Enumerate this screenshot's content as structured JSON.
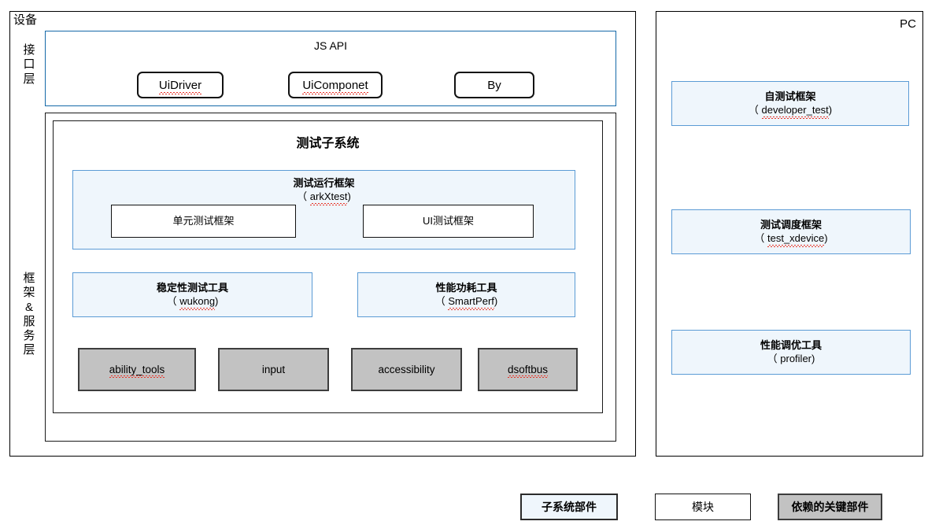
{
  "device_panel": {
    "tag": "设备",
    "layers": [
      {
        "id": "interface",
        "label": "接口层"
      },
      {
        "id": "framework_service",
        "label": "框架&服务层"
      }
    ],
    "js_api": {
      "title": "JS API",
      "chips": [
        {
          "label": "UiDriver",
          "misspelled": true
        },
        {
          "label": "UiComponet",
          "misspelled": true
        },
        {
          "label": "By",
          "misspelled": false
        }
      ]
    },
    "test_subsystem": {
      "title": "测试子系统",
      "run_framework": {
        "name": "测试运行框架",
        "pkg": "（ arkXtest)",
        "pkg_word": "arkXtest",
        "modules": [
          {
            "label": "单元测试框架"
          },
          {
            "label": "UI测试框架"
          }
        ]
      },
      "tools": [
        {
          "name": "稳定性测试工具",
          "pkg_open": "（ ",
          "pkg_word": "wukong",
          "pkg_close": ")"
        },
        {
          "name": "性能功耗工具",
          "pkg_open": "（ ",
          "pkg_word": "SmartPerf",
          "pkg_close": ")"
        }
      ],
      "dependencies": [
        {
          "label": "ability_tools",
          "misspelled": true
        },
        {
          "label": "input",
          "misspelled": false
        },
        {
          "label": "accessibility",
          "misspelled": false
        },
        {
          "label": "dsoftbus",
          "misspelled": true
        }
      ]
    }
  },
  "pc_panel": {
    "tag": "PC",
    "components": [
      {
        "name": "自测试框架",
        "pkg_open": "（ ",
        "pkg_word": "developer_test",
        "pkg_close": ")"
      },
      {
        "name": "测试调度框架",
        "pkg_open": "（ ",
        "pkg_word": "test_xdevice",
        "pkg_close": ")"
      },
      {
        "name": "性能调优工具",
        "pkg_open": "（ ",
        "pkg_word": "profiler",
        "pkg_close": ")"
      }
    ]
  },
  "legend": [
    {
      "label": "子系统部件",
      "kind": "subsystem-component"
    },
    {
      "label": "模块",
      "kind": "module"
    },
    {
      "label": "依赖的关键部件",
      "kind": "key-dependency"
    }
  ],
  "colors": {
    "blue_border": "#1569a8",
    "comp_border": "#5b9bd5",
    "comp_fill": "#eff6fc",
    "dep_fill": "#c2c2c2",
    "dep_border": "#3d3d3d",
    "frame_border": "#1a1a1a",
    "spell_red": "#e8342a"
  }
}
